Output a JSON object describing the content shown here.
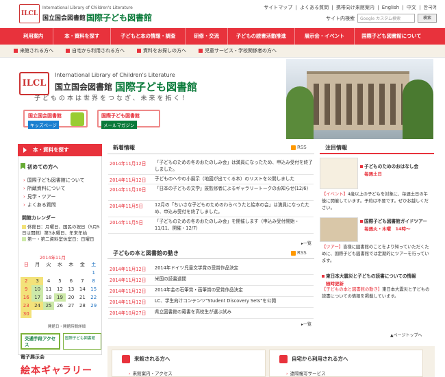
{
  "header": {
    "logo_mark": "ILCL",
    "logo_en": "International Library of Children's Literature",
    "logo_ja1": "国立国会図書館",
    "logo_ja2": "国際子ども図書館",
    "util_links": [
      "サイトマップ",
      "|",
      "よくある質問",
      "|",
      "携帯向け来館案内",
      "|",
      "English",
      "|",
      "中文",
      "|",
      "한국어"
    ],
    "search_label": "サイト内検索",
    "search_placeholder": "Google カスタム検索",
    "search_button": "検索"
  },
  "main_nav": [
    "利用案内",
    "本・資料を探す",
    "子どもと本の情報・調査",
    "研修・交流",
    "子どもの読書活動推進",
    "展示会・イベント",
    "国際子ども図書館について"
  ],
  "sub_nav": [
    "来館される方へ",
    "自宅から利用される方へ",
    "資料をお探しの方へ",
    "児童サービス・学校関係者の方へ"
  ],
  "hero": {
    "mark": "ILCL",
    "en": "International Library of Children's Literature",
    "ja1": "国立国会図書館",
    "ja2": "国際子ども図書館",
    "tagline": "子どもの本は世界をつなぎ、未来を拓く！",
    "banner_kids_1": "国立国会図書館",
    "banner_kids_2": "キッズページ",
    "banner_mail_1": "国際子ども図書館",
    "banner_mail_2": "メールマガジン"
  },
  "sidebar": {
    "head": "本・資料を探す",
    "first_time": "初めての方へ",
    "links": [
      "国際子ども図書館について",
      "所蔵資料について",
      "見学・ツアー",
      "よくある質問"
    ],
    "calendar_title": "開館カレンダー",
    "calendar_note_1": "休館日：月曜日、国民の祝日（5月5日は開館）第3水曜日、年末年始",
    "calendar_note_2": "第一・第二資料室休室日：日曜日",
    "month": "2014年11月",
    "weekdays": [
      "日",
      "月",
      "火",
      "水",
      "木",
      "金",
      "土"
    ],
    "weeks": [
      [
        "",
        "",
        "",
        "",
        "",
        "",
        "1"
      ],
      [
        "2",
        "3",
        "4",
        "5",
        "6",
        "7",
        "8"
      ],
      [
        "9",
        "10",
        "11",
        "12",
        "13",
        "14",
        "15"
      ],
      [
        "16",
        "17",
        "18",
        "19",
        "20",
        "21",
        "22"
      ],
      [
        "23",
        "24",
        "25",
        "26",
        "27",
        "28",
        "29"
      ],
      [
        "30",
        "",
        "",
        "",
        "",
        "",
        ""
      ]
    ],
    "legend": "開館日・開館時間詳細",
    "access_banner": "交通手段アクセス",
    "map_banner": "国際子ども図書館",
    "digital_title": "電子展示会",
    "digital_banner": "絵本ギャラリー"
  },
  "news": {
    "title": "新着情報",
    "rss": "RSS",
    "items": [
      {
        "date": "2014年11月12日",
        "text": "「子どものための冬のおたのしみ会」は満員になったため、申込み受付を終了しました。"
      },
      {
        "date": "2014年11月12日",
        "text": "子どものへやの小展示（地図が出てくる本）のリストを公開しました"
      },
      {
        "date": "2014年11月10日",
        "text": "「日本の子どもの文学」展監修者によるギャラリートークのお知らせ(12/6)"
      },
      {
        "date": "2014年11月5日",
        "text": "12月の「ちいさな子どものためのわらべうたと絵本の会」は満員になったため、申込み受付を終了しました。"
      },
      {
        "date": "2014年11月5日",
        "text": "「子どものための冬のおたのしみ会」を開催します（申込み受付開始・11/11、開催・12/7）"
      }
    ],
    "more": "一覧"
  },
  "trends": {
    "title": "子どもの本と図書館の動き",
    "rss": "RSS",
    "items": [
      {
        "date": "2014年11月12日",
        "text": "2014年ドイツ児童文学賞の受賞作品決定"
      },
      {
        "date": "2014年11月12日",
        "text": "米国の読書週間"
      },
      {
        "date": "2014年11月12日",
        "text": "2014年金の石筆賞・画筆賞の受賞作品決定"
      },
      {
        "date": "2014年11月12日",
        "text": "LC、学生向けコンテンツ\"Student Discovery Sets\"を公開"
      },
      {
        "date": "2014年10月27日",
        "text": "県立図書館の蔵書を高校生が選ぶ試み"
      }
    ],
    "more": "一覧"
  },
  "attention": {
    "title": "注目情報",
    "items": [
      {
        "heading": "子どものためのおはなし会",
        "sub": "毎週土日",
        "tag": "【イベント】",
        "body": "4歳以上の子どもを対象に、毎週土日の午後に開催しています。予約は不要です。ぜひお越しください。"
      },
      {
        "heading": "国際子ども図書館ガイドツアー",
        "sub": "毎週火・木曜　14時～",
        "tag": "【ツアー】",
        "body": "皆様に図書館のことをより知っていただくために、国際子ども図書館では定期的にツアーを行っています。"
      },
      {
        "heading": "東日本大震災と子どもの読書についての情報",
        "sub": "随時更新",
        "tag": "【子どもの本と図書館の動き】",
        "body": "東日本大震災と子どもの読書についての情報を掲載しています。"
      }
    ],
    "pagetop": "ページトップへ"
  },
  "bottom": {
    "box1_title": "来館される方へ",
    "box1_link": "来館案内・アクセス",
    "box2_title": "自宅から利用される方へ",
    "box2_link": "遠隔複写サービス"
  },
  "colors": {
    "accent": "#e8323c",
    "brand_green": "#0a7a3a"
  }
}
